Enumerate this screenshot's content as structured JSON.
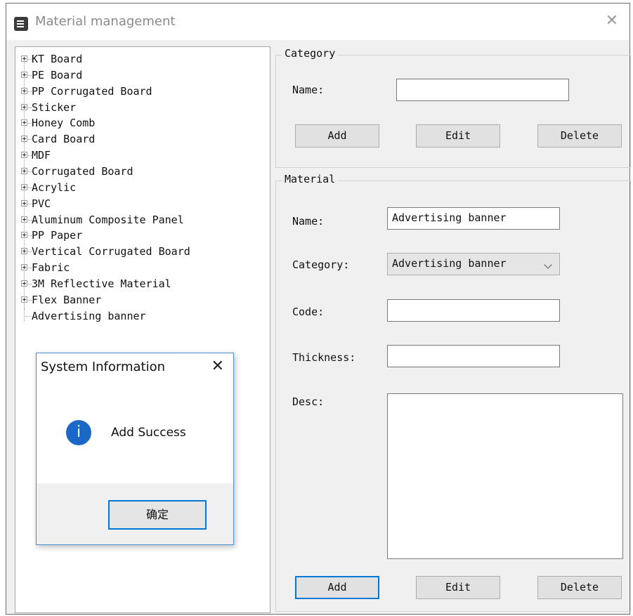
{
  "window": {
    "title": "Material management",
    "icon": "list-icon",
    "close_glyph": "✕"
  },
  "tree": {
    "items": [
      {
        "label": "KT Board"
      },
      {
        "label": "PE Board"
      },
      {
        "label": "PP Corrugated Board"
      },
      {
        "label": "Sticker"
      },
      {
        "label": "Honey Comb"
      },
      {
        "label": "Card Board"
      },
      {
        "label": "MDF"
      },
      {
        "label": "Corrugated Board"
      },
      {
        "label": "Acrylic"
      },
      {
        "label": "PVC"
      },
      {
        "label": "Aluminum Composite Panel"
      },
      {
        "label": "PP Paper"
      },
      {
        "label": "Vertical Corrugated Board"
      },
      {
        "label": "Fabric"
      },
      {
        "label": "3M Reflective Material"
      },
      {
        "label": "Flex Banner"
      },
      {
        "label": "Advertising banner"
      }
    ]
  },
  "category": {
    "group_label": "Category",
    "name_label": "Name:",
    "name_value": "",
    "add_label": "Add",
    "edit_label": "Edit",
    "delete_label": "Delete"
  },
  "material": {
    "group_label": "Material",
    "name_label": "Name:",
    "name_value": "Advertising banner",
    "category_label": "Category:",
    "category_value": "Advertising banner",
    "code_label": "Code:",
    "code_value": "",
    "thickness_label": "Thickness:",
    "thickness_value": "",
    "desc_label": "Desc:",
    "desc_value": "",
    "add_label": "Add",
    "edit_label": "Edit",
    "delete_label": "Delete"
  },
  "dialog": {
    "title": "System Information",
    "close_glyph": "✕",
    "icon_glyph": "i",
    "message": "Add Success",
    "ok_label": "确定"
  },
  "colors": {
    "accent": "#0078d7",
    "info_icon": "#1a67c6"
  }
}
